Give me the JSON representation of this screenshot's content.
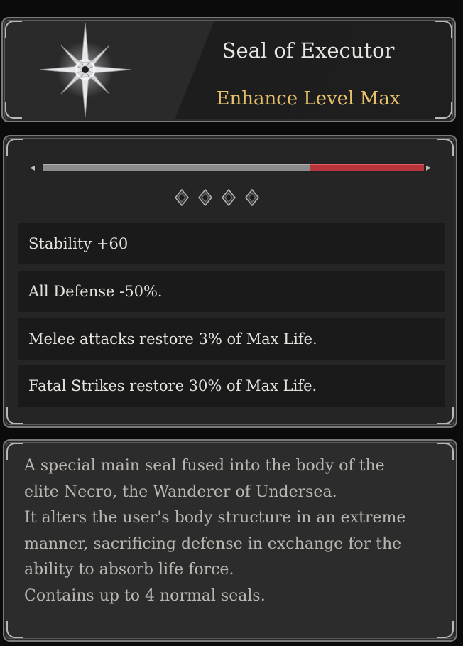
{
  "item": {
    "name": "Seal of Executor",
    "enhance_level": "Enhance Level Max",
    "icon": "star-seal-icon"
  },
  "enhance": {
    "progress_fraction": 0.3,
    "slot_count": 4
  },
  "stats": [
    "Stability +60",
    "All Defense -50%.",
    "Melee attacks restore 3% of Max Life.",
    "Fatal Strikes restore 30% of Max Life."
  ],
  "description": {
    "lines": [
      "A special main seal fused into the body of the",
      "elite Necro, the Wanderer of Undersea.",
      "It alters the user's body structure in an extreme",
      "manner, sacrificing defense in exchange for the",
      "ability to absorb life force.",
      "Contains up to 4 normal seals."
    ]
  },
  "colors": {
    "accent_gold": "#e6c06a",
    "progress_red": "#b8353b",
    "progress_gray": "#8c8c8c"
  }
}
